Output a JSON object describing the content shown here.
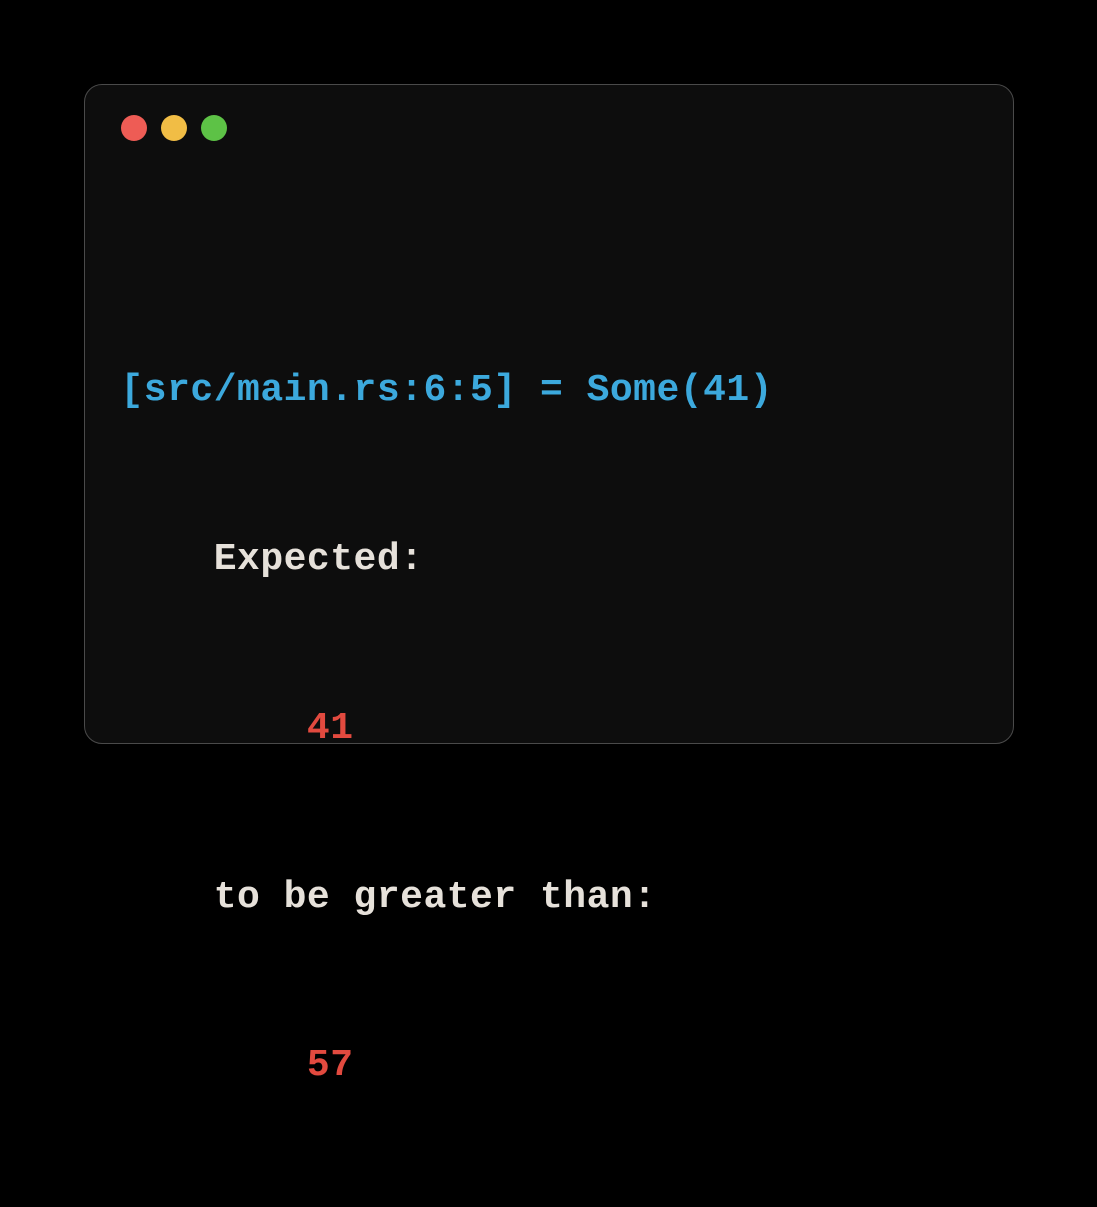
{
  "terminal": {
    "location_line": "[src/main.rs:6:5] = Some(41)",
    "expected_label": "    Expected:",
    "expected_value": "        41",
    "condition_label": "    to be greater than:",
    "actual_value": "        57"
  },
  "colors": {
    "blue": "#3ca9dd",
    "white": "#e6e1da",
    "red": "#e24a3f",
    "background": "#0d0d0d",
    "page_background": "#000000"
  }
}
